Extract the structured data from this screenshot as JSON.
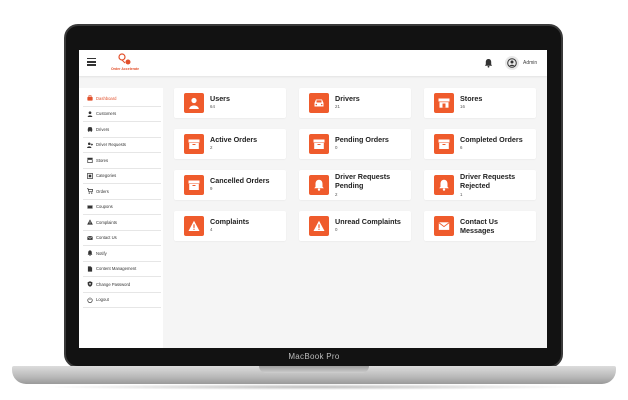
{
  "device": {
    "label": "MacBook Pro"
  },
  "header": {
    "logo_text": "Order Accelerate",
    "user_name": "Admin"
  },
  "sidebar": {
    "items": [
      {
        "label": "Dashboard",
        "icon": "dashboard-icon",
        "active": true
      },
      {
        "label": "Customers",
        "icon": "user-icon"
      },
      {
        "label": "Drivers",
        "icon": "car-icon"
      },
      {
        "label": "Driver Requests",
        "icon": "user-plus-icon"
      },
      {
        "label": "Stores",
        "icon": "store-icon"
      },
      {
        "label": "Categories",
        "icon": "category-icon"
      },
      {
        "label": "Orders",
        "icon": "cart-icon"
      },
      {
        "label": "Coupons",
        "icon": "ticket-icon"
      },
      {
        "label": "Complaints",
        "icon": "warning-icon"
      },
      {
        "label": "Contact Us",
        "icon": "envelope-icon"
      },
      {
        "label": "Notify",
        "icon": "bell-icon"
      },
      {
        "label": "Content Management",
        "icon": "document-icon"
      },
      {
        "label": "Change Password",
        "icon": "shield-icon"
      },
      {
        "label": "Logout",
        "icon": "power-icon"
      }
    ]
  },
  "cards": [
    {
      "title": "Users",
      "value": "64",
      "icon": "user-icon"
    },
    {
      "title": "Drivers",
      "value": "21",
      "icon": "car-icon"
    },
    {
      "title": "Stores",
      "value": "16",
      "icon": "store-icon"
    },
    {
      "title": "Active Orders",
      "value": "2",
      "icon": "box-icon"
    },
    {
      "title": "Pending Orders",
      "value": "0",
      "icon": "box-icon"
    },
    {
      "title": "Completed Orders",
      "value": "6",
      "icon": "box-icon"
    },
    {
      "title": "Cancelled Orders",
      "value": "9",
      "icon": "box-icon"
    },
    {
      "title": "Driver Requests Pending",
      "value": "2",
      "icon": "bell-icon"
    },
    {
      "title": "Driver Requests Rejected",
      "value": "1",
      "icon": "bell-icon"
    },
    {
      "title": "Complaints",
      "value": "4",
      "icon": "warning-icon"
    },
    {
      "title": "Unread Complaints",
      "value": "0",
      "icon": "warning-icon"
    },
    {
      "title": "Contact Us Messages",
      "value": "7",
      "icon": "envelope-icon"
    }
  ],
  "colors": {
    "accent": "#ef5b2c",
    "background": "#f5f5f5",
    "active_text": "#e2502b"
  }
}
